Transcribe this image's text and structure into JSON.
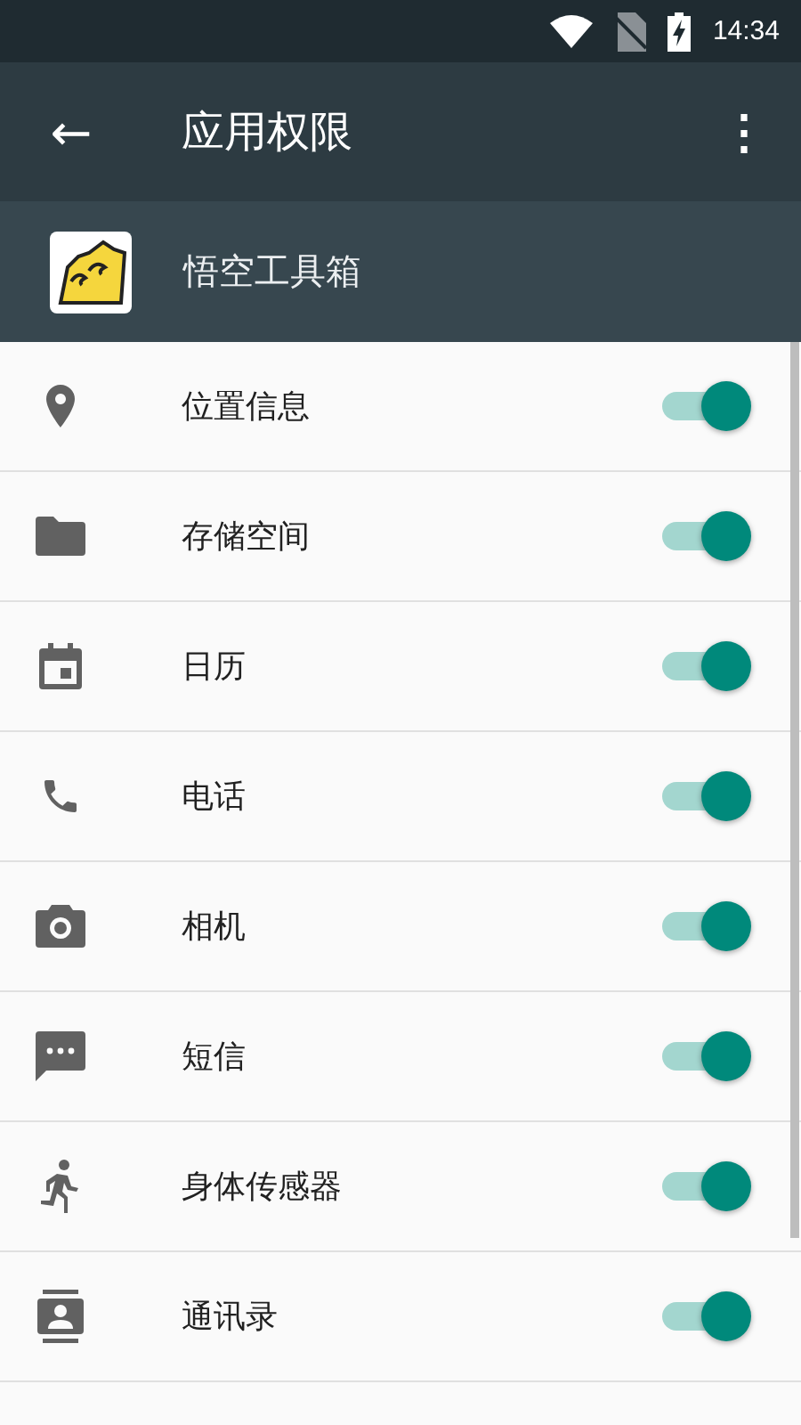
{
  "status_bar": {
    "time": "14:34"
  },
  "toolbar": {
    "back": "←",
    "title": "应用权限",
    "menu": "⋮"
  },
  "app": {
    "name": "悟空工具箱"
  },
  "permissions": [
    {
      "kind": "location",
      "label": "位置信息",
      "on": true
    },
    {
      "kind": "folder",
      "label": "存储空间",
      "on": true
    },
    {
      "kind": "calendar",
      "label": "日历",
      "on": true
    },
    {
      "kind": "phone",
      "label": "电话",
      "on": true
    },
    {
      "kind": "camera",
      "label": "相机",
      "on": true
    },
    {
      "kind": "sms",
      "label": "短信",
      "on": true
    },
    {
      "kind": "sensor",
      "label": "身体传感器",
      "on": true
    },
    {
      "kind": "contacts",
      "label": "通讯录",
      "on": true
    }
  ]
}
